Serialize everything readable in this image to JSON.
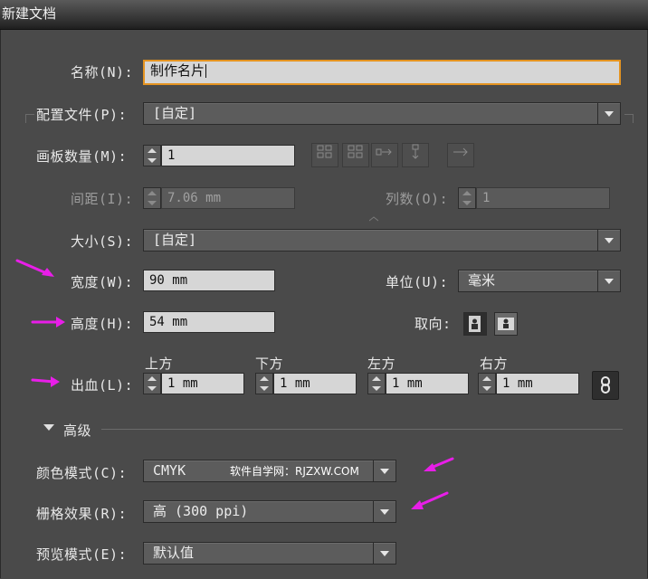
{
  "window": {
    "title": "新建文档"
  },
  "name": {
    "label": "名称(N):",
    "value": "制作名片"
  },
  "profile": {
    "label": "配置文件(P):",
    "value": "[自定]"
  },
  "artboards": {
    "label": "画板数量(M):",
    "value": "1"
  },
  "spacing": {
    "label": "间距(I):",
    "value": "7.06 mm"
  },
  "columns": {
    "label": "列数(O):",
    "value": "1"
  },
  "size": {
    "label": "大小(S):",
    "value": "[自定]"
  },
  "width": {
    "label": "宽度(W):",
    "value": "90 mm"
  },
  "units": {
    "label": "单位(U):",
    "value": "毫米"
  },
  "height": {
    "label": "高度(H):",
    "value": "54 mm"
  },
  "orientation": {
    "label": "取向:"
  },
  "bleed": {
    "label": "出血(L):",
    "top_label": "上方",
    "top": "1 mm",
    "bottom_label": "下方",
    "bottom": "1 mm",
    "left_label": "左方",
    "left": "1 mm",
    "right_label": "右方",
    "right": "1 mm"
  },
  "advanced": {
    "label": "高级"
  },
  "color_mode": {
    "label": "颜色模式(C):",
    "value": "CMYK",
    "watermark": "软件自学网：RJZXW.COM"
  },
  "raster": {
    "label": "栅格效果(R):",
    "value": "高 (300 ppi)"
  },
  "preview": {
    "label": "预览模式(E):",
    "value": "默认值"
  },
  "colors": {
    "accent": "#e49320",
    "annotation": "#e81ee8"
  }
}
